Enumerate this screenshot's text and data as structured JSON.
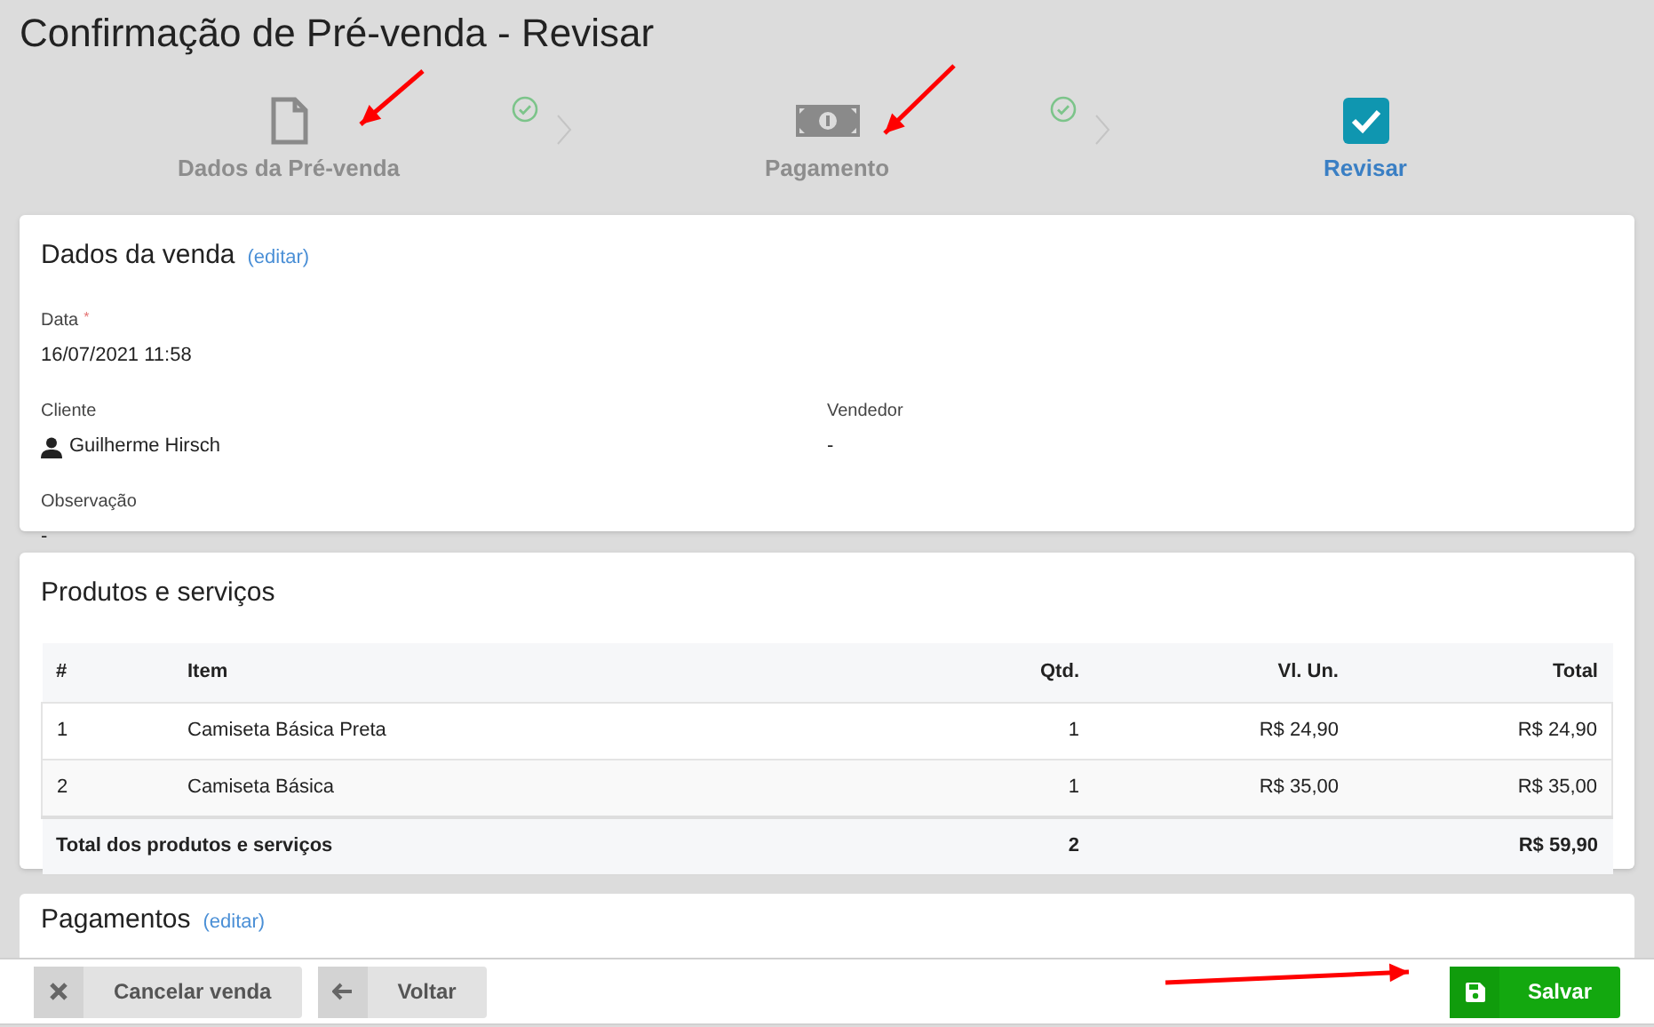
{
  "title": "Confirmação de Pré-venda - Revisar",
  "steps": [
    {
      "label": "Dados da Pré-venda",
      "kind": "document",
      "completed": true,
      "selected": false
    },
    {
      "label": "Pagamento",
      "kind": "money",
      "completed": true,
      "selected": false
    },
    {
      "label": "Revisar",
      "kind": "review",
      "completed": false,
      "selected": true
    }
  ],
  "sale_card": {
    "title": "Dados da venda",
    "edit_link": "(editar)",
    "fields": [
      {
        "label": "Data",
        "required_mark": "*",
        "value": "16/07/2021 11:58",
        "kind": "text"
      },
      {
        "label": "Cliente",
        "value": "Guilherme Hirsch",
        "kind": "person"
      },
      {
        "label": "Vendedor",
        "value": "-",
        "kind": "text"
      },
      {
        "label": "Observação",
        "value": "-",
        "kind": "text"
      }
    ]
  },
  "products_card": {
    "title": "Produtos e serviços",
    "table": {
      "columns": [
        {
          "label": "#"
        },
        {
          "label": "Item"
        },
        {
          "label": "Qtd."
        },
        {
          "label": "Vl. Un."
        },
        {
          "label": "Total"
        }
      ],
      "rows": [
        [
          "1",
          "Camiseta Básica Preta",
          "1",
          "R$ 24,90",
          "R$ 24,90"
        ],
        [
          "2",
          "Camiseta Básica",
          "1",
          "R$ 35,00",
          "R$ 35,00"
        ]
      ],
      "footer": {
        "label": "Total dos produtos e serviços",
        "quantity": "2",
        "total": "R$ 59,90"
      }
    }
  },
  "payments_card": {
    "title": "Pagamentos",
    "edit_link": "(editar)"
  },
  "buttons": [
    {
      "label": "Cancelar venda",
      "kind": "cancel"
    },
    {
      "label": "Voltar",
      "kind": "back"
    },
    {
      "label": "Salvar",
      "kind": "save"
    }
  ]
}
